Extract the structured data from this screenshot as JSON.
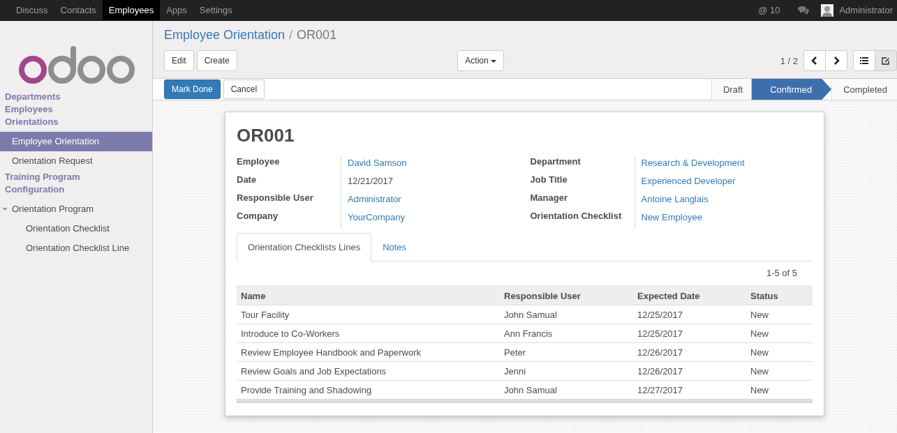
{
  "top_menu": [
    {
      "label": "Discuss",
      "selected": false
    },
    {
      "label": "Contacts",
      "selected": false
    },
    {
      "label": "Employees",
      "selected": true
    },
    {
      "label": "Apps",
      "selected": false
    },
    {
      "label": "Settings",
      "selected": false
    }
  ],
  "systray": {
    "mentions": "@ 10",
    "user": "Administrator"
  },
  "sidebar": [
    {
      "kind": "header",
      "label": "Departments",
      "selected": false
    },
    {
      "kind": "header",
      "label": "Employees",
      "selected": false
    },
    {
      "kind": "header",
      "label": "Orientations",
      "selected": false
    },
    {
      "kind": "item",
      "label": "Employee Orientation",
      "selected": true
    },
    {
      "kind": "item",
      "label": "Orientation Request",
      "selected": false
    },
    {
      "kind": "header",
      "label": "Training Program",
      "selected": false
    },
    {
      "kind": "header",
      "label": "Configuration",
      "selected": false
    },
    {
      "kind": "item",
      "label": "Orientation Program",
      "selected": false,
      "expanded": true,
      "children": [
        {
          "label": "Orientation Checklist",
          "selected": false
        },
        {
          "label": "Orientation Checklist Line",
          "selected": false
        }
      ]
    }
  ],
  "breadcrumb": {
    "parent": "Employee Orientation",
    "separator": "/",
    "current": "OR001"
  },
  "buttons": {
    "edit": "Edit",
    "create": "Create",
    "action": "Action",
    "pager": "1 / 2"
  },
  "form_buttons": [
    {
      "label": "Mark Done",
      "kind": "primary"
    },
    {
      "label": "Cancel",
      "kind": "default"
    }
  ],
  "stages": [
    {
      "label": "Draft",
      "selected": false
    },
    {
      "label": "Confirmed",
      "selected": true
    },
    {
      "label": "Completed",
      "selected": false
    }
  ],
  "record": {
    "title": "OR001",
    "fields_left": [
      {
        "label": "Employee",
        "value": "David Samson",
        "kind": "link"
      },
      {
        "label": "Date",
        "value": "12/21/2017",
        "kind": "text"
      },
      {
        "label": "Responsible User",
        "value": "Administrator",
        "kind": "link"
      },
      {
        "label": "Company",
        "value": "YourCompany",
        "kind": "link"
      }
    ],
    "fields_right": [
      {
        "label": "Department",
        "value": "Research & Development",
        "kind": "link"
      },
      {
        "label": "Job Title",
        "value": "Experienced Developer",
        "kind": "link"
      },
      {
        "label": "Manager",
        "value": "Antoine Langlais",
        "kind": "link"
      },
      {
        "label": "Orientation Checklist",
        "value": "New Employee",
        "kind": "link"
      }
    ]
  },
  "tabs": [
    {
      "label": "Orientation Checklists Lines",
      "selected": true
    },
    {
      "label": "Notes",
      "selected": false
    }
  ],
  "table": {
    "pager": "1-5 of 5",
    "columns": [
      "Name",
      "Responsible User",
      "Expected Date",
      "Status"
    ],
    "rows": [
      [
        "Tour Facility",
        "John Samual",
        "12/25/2017",
        "New"
      ],
      [
        "Introduce to Co-Workers",
        "Ann Francis",
        "12/25/2017",
        "New"
      ],
      [
        "Review Employee Handbook and Paperwork",
        "Peter",
        "12/26/2017",
        "New"
      ],
      [
        "Review Goals and Job Expectations",
        "Jenni",
        "12/26/2017",
        "New"
      ],
      [
        "Provide Training and Shadowing",
        "John Samual",
        "12/27/2017",
        "New"
      ]
    ]
  }
}
